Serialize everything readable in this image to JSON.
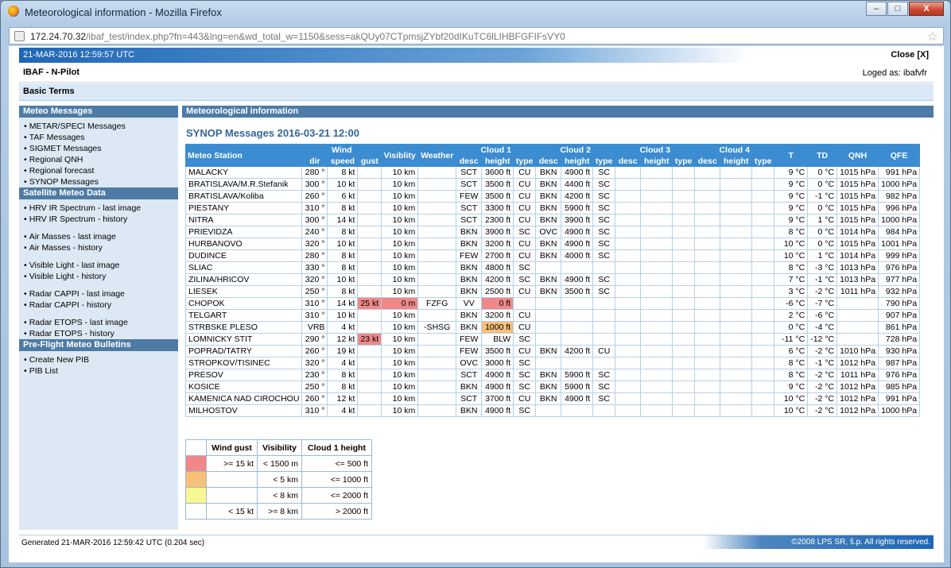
{
  "window": {
    "title": "Meteorological information - Mozilla Firefox",
    "url_host": "172.24.70.32",
    "url_path": "/ibaf_test/index.php?fn=443&lng=en&wd_total_w=1150&sess=akQUy07CTpmsjZYbf20dIKuTC6lLIHBFGFIFsVY0",
    "min_label": "–",
    "max_label": "□",
    "close_label": "X"
  },
  "header": {
    "datetime": "21-MAR-2016 12:59:57 UTC",
    "close": "Close [X]",
    "app_name": "IBAF - N-Pilot",
    "logged_as": "Loged as:  ibafvfr",
    "basic_terms": "Basic Terms"
  },
  "sidebar": {
    "sections": [
      {
        "title": "Meteo Messages",
        "groups": [
          [
            "METAR/SPECI Messages",
            "TAF Messages",
            "SIGMET Messages",
            "Regional QNH",
            "Regional forecast",
            "SYNOP Messages"
          ]
        ]
      },
      {
        "title": "Satellite Meteo Data",
        "groups": [
          [
            "HRV IR Spectrum - last image",
            "HRV IR Spectrum - history"
          ],
          [
            "Air Masses - last image",
            "Air Masses - history"
          ],
          [
            "Visible Light - last image",
            "Visible Light - history"
          ],
          [
            "Radar CAPPI - last image",
            "Radar CAPPI - history"
          ],
          [
            "Radar ETOPS - last image",
            "Radar ETOPS - history"
          ]
        ]
      },
      {
        "title": "Pre-Flight Meteo Bulletins",
        "groups": [
          [
            "Create New PIB",
            "PIB List"
          ]
        ]
      }
    ]
  },
  "main": {
    "title": "Meteorological information",
    "synop_heading": "SYNOP Messages    2016-03-21 12:00",
    "table": {
      "top_headers": {
        "station": "Meteo Station",
        "wind": "Wind",
        "visibility": "Visiblity",
        "weather": "Weather",
        "cloud1": "Cloud 1",
        "cloud2": "Cloud 2",
        "cloud3": "Cloud 3",
        "cloud4": "Cloud 4",
        "t": "T",
        "td": "TD",
        "qnh": "QNH",
        "qfe": "QFE"
      },
      "sub_headers": {
        "dir": "dir",
        "speed": "speed",
        "gust": "gust",
        "desc": "desc",
        "height": "height",
        "type": "type"
      },
      "rows": [
        [
          "MALACKY",
          "280 °",
          "8 kt",
          "",
          "10 km",
          "",
          "SCT",
          "3600 ft",
          "CU",
          "BKN",
          "4900 ft",
          "SC",
          "",
          "",
          "",
          "",
          "",
          "",
          "9 °C",
          "0 °C",
          "1015 hPa",
          "991 hPa"
        ],
        [
          "BRATISLAVA/M.R.Stefanik",
          "300 °",
          "10 kt",
          "",
          "10 km",
          "",
          "SCT",
          "3500 ft",
          "CU",
          "BKN",
          "4400 ft",
          "SC",
          "",
          "",
          "",
          "",
          "",
          "",
          "9 °C",
          "0 °C",
          "1015 hPa",
          "1000 hPa"
        ],
        [
          "BRATISLAVA/Koliba",
          "260 °",
          "6 kt",
          "",
          "10 km",
          "",
          "FEW",
          "3500 ft",
          "CU",
          "BKN",
          "4200 ft",
          "SC",
          "",
          "",
          "",
          "",
          "",
          "",
          "9 °C",
          "-1 °C",
          "1015 hPa",
          "982 hPa"
        ],
        [
          "PIESTANY",
          "310 °",
          "8 kt",
          "",
          "10 km",
          "",
          "SCT",
          "3300 ft",
          "CU",
          "BKN",
          "5900 ft",
          "SC",
          "",
          "",
          "",
          "",
          "",
          "",
          "9 °C",
          "0 °C",
          "1015 hPa",
          "996 hPa"
        ],
        [
          "NITRA",
          "300 °",
          "14 kt",
          "",
          "10 km",
          "",
          "SCT",
          "2300 ft",
          "CU",
          "BKN",
          "3900 ft",
          "SC",
          "",
          "",
          "",
          "",
          "",
          "",
          "9 °C",
          "1 °C",
          "1015 hPa",
          "1000 hPa"
        ],
        [
          "PRIEVIDZA",
          "240 °",
          "8 kt",
          "",
          "10 km",
          "",
          "BKN",
          "3900 ft",
          "SC",
          "OVC",
          "4900 ft",
          "SC",
          "",
          "",
          "",
          "",
          "",
          "",
          "8 °C",
          "0 °C",
          "1014 hPa",
          "984 hPa"
        ],
        [
          "HURBANOVO",
          "320 °",
          "10 kt",
          "",
          "10 km",
          "",
          "BKN",
          "3200 ft",
          "CU",
          "BKN",
          "4900 ft",
          "SC",
          "",
          "",
          "",
          "",
          "",
          "",
          "10 °C",
          "0 °C",
          "1015 hPa",
          "1001 hPa"
        ],
        [
          "DUDINCE",
          "280 °",
          "8 kt",
          "",
          "10 km",
          "",
          "FEW",
          "2700 ft",
          "CU",
          "BKN",
          "4000 ft",
          "SC",
          "",
          "",
          "",
          "",
          "",
          "",
          "10 °C",
          "1 °C",
          "1014 hPa",
          "999 hPa"
        ],
        [
          "SLIAC",
          "330 °",
          "8 kt",
          "",
          "10 km",
          "",
          "BKN",
          "4800 ft",
          "SC",
          "",
          "",
          "",
          "",
          "",
          "",
          "",
          "",
          "",
          "8 °C",
          "-3 °C",
          "1013 hPa",
          "976 hPa"
        ],
        [
          "ZILINA/HRICOV",
          "320 °",
          "10 kt",
          "",
          "10 km",
          "",
          "BKN",
          "4200 ft",
          "SC",
          "BKN",
          "4900 ft",
          "SC",
          "",
          "",
          "",
          "",
          "",
          "",
          "7 °C",
          "-1 °C",
          "1013 hPa",
          "977 hPa"
        ],
        [
          "LIESEK",
          "250 °",
          "8 kt",
          "",
          "10 km",
          "",
          "BKN",
          "2500 ft",
          "CU",
          "BKN",
          "3500 ft",
          "SC",
          "",
          "",
          "",
          "",
          "",
          "",
          "3 °C",
          "-2 °C",
          "1011 hPa",
          "932 hPa"
        ],
        [
          "CHOPOK",
          "310 °",
          "14 kt",
          "25 kt",
          "0 m",
          "FZFG",
          "VV",
          "0 ft",
          "",
          "",
          "",
          "",
          "",
          "",
          "",
          "",
          "",
          "",
          "-6 °C",
          "-7 °C",
          "",
          "790 hPa"
        ],
        [
          "TELGART",
          "310 °",
          "10 kt",
          "",
          "10 km",
          "",
          "BKN",
          "3200 ft",
          "CU",
          "",
          "",
          "",
          "",
          "",
          "",
          "",
          "",
          "",
          "2 °C",
          "-6 °C",
          "",
          "907 hPa"
        ],
        [
          "STRBSKE PLESO",
          "VRB",
          "4 kt",
          "",
          "10 km",
          "-SHSG",
          "BKN",
          "1000 ft",
          "CU",
          "",
          "",
          "",
          "",
          "",
          "",
          "",
          "",
          "",
          "0 °C",
          "-4 °C",
          "",
          "861 hPa"
        ],
        [
          "LOMNICKY STIT",
          "290 °",
          "12 kt",
          "23 kt",
          "10 km",
          "",
          "FEW",
          "BLW",
          "SC",
          "",
          "",
          "",
          "",
          "",
          "",
          "",
          "",
          "",
          "-11 °C",
          "-12 °C",
          "",
          "728 hPa"
        ],
        [
          "POPRAD/TATRY",
          "260 °",
          "19 kt",
          "",
          "10 km",
          "",
          "FEW",
          "3500 ft",
          "CU",
          "BKN",
          "4200 ft",
          "CU",
          "",
          "",
          "",
          "",
          "",
          "",
          "6 °C",
          "-2 °C",
          "1010 hPa",
          "930 hPa"
        ],
        [
          "STROPKOV/TISINEC",
          "320 °",
          "4 kt",
          "",
          "10 km",
          "",
          "OVC",
          "3000 ft",
          "SC",
          "",
          "",
          "",
          "",
          "",
          "",
          "",
          "",
          "",
          "8 °C",
          "-1 °C",
          "1012 hPa",
          "987 hPa"
        ],
        [
          "PRESOV",
          "230 °",
          "8 kt",
          "",
          "10 km",
          "",
          "SCT",
          "4900 ft",
          "SC",
          "BKN",
          "5900 ft",
          "SC",
          "",
          "",
          "",
          "",
          "",
          "",
          "8 °C",
          "-2 °C",
          "1011 hPa",
          "976 hPa"
        ],
        [
          "KOSICE",
          "250 °",
          "8 kt",
          "",
          "10 km",
          "",
          "BKN",
          "4900 ft",
          "SC",
          "BKN",
          "5900 ft",
          "SC",
          "",
          "",
          "",
          "",
          "",
          "",
          "9 °C",
          "-2 °C",
          "1012 hPa",
          "985 hPa"
        ],
        [
          "KAMENICA NAD CIROCHOU",
          "260 °",
          "12 kt",
          "",
          "10 km",
          "",
          "SCT",
          "3700 ft",
          "CU",
          "BKN",
          "4900 ft",
          "SC",
          "",
          "",
          "",
          "",
          "",
          "",
          "10 °C",
          "-2 °C",
          "1012 hPa",
          "991 hPa"
        ],
        [
          "MILHOSTOV",
          "310 °",
          "4 kt",
          "",
          "10 km",
          "",
          "BKN",
          "4900 ft",
          "SC",
          "",
          "",
          "",
          "",
          "",
          "",
          "",
          "",
          "",
          "10 °C",
          "-2 °C",
          "1012 hPa",
          "1000 hPa"
        ]
      ],
      "highlights": [
        {
          "row": 11,
          "col": 3,
          "level": "red"
        },
        {
          "row": 11,
          "col": 4,
          "level": "red"
        },
        {
          "row": 11,
          "col": 7,
          "level": "red"
        },
        {
          "row": 13,
          "col": 7,
          "level": "orange"
        },
        {
          "row": 14,
          "col": 3,
          "level": "red"
        }
      ]
    },
    "legend": {
      "headers": [
        "Wind gust",
        "Visibility",
        "Cloud 1 height"
      ],
      "rows": [
        {
          "color": "#f08888",
          "cells": [
            ">= 15 kt",
            "< 1500 m",
            "<= 500 ft"
          ]
        },
        {
          "color": "#f8c078",
          "cells": [
            "",
            "< 5 km",
            "<= 1000 ft"
          ]
        },
        {
          "color": "#f8f890",
          "cells": [
            "",
            "< 8 km",
            "<= 2000 ft"
          ]
        },
        {
          "color": "#ffffff",
          "cells": [
            "< 15 kt",
            ">= 8 km",
            "> 2000 ft"
          ]
        }
      ]
    }
  },
  "footer": {
    "generated": "Generated 21-MAR-2016 12:59:42 UTC (0.204 sec)",
    "copyright": "©2008 LPS SR, š.p. All rights reserved."
  },
  "colors": {
    "accent": "#3b8cd0",
    "sidebar_head": "#4d7ba6",
    "gust_red": "#f08888",
    "cloud_orange": "#f8c078"
  }
}
